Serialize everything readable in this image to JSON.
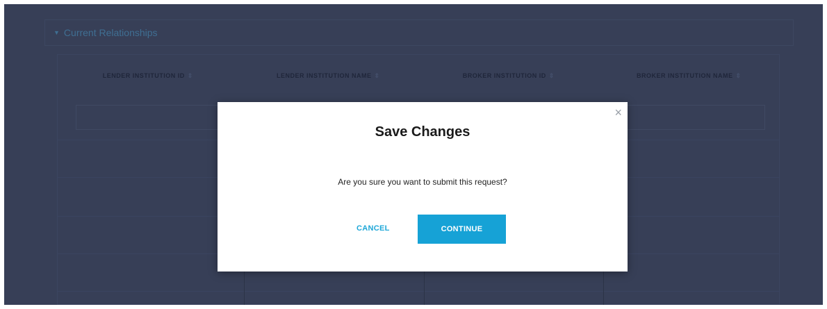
{
  "section": {
    "title": "Current Relationships",
    "caret_icon": "triangle-down"
  },
  "table": {
    "columns": [
      {
        "label": "LENDER INSTITUTION ID"
      },
      {
        "label": "LENDER INSTITUTION NAME"
      },
      {
        "label": "BROKER INSTITUTION ID"
      },
      {
        "label": "BROKER INSTITUTION NAME"
      }
    ],
    "sort_icon": "sort-arrows",
    "sort_glyph": "⇕"
  },
  "modal": {
    "title": "Save Changes",
    "message": "Are you sure you want to submit this request?",
    "cancel_label": "CANCEL",
    "continue_label": "CONTINUE",
    "close_glyph": "×"
  },
  "colors": {
    "overlay": "#373f57",
    "accent": "#16a2d6",
    "modal_bg": "#ffffff"
  }
}
